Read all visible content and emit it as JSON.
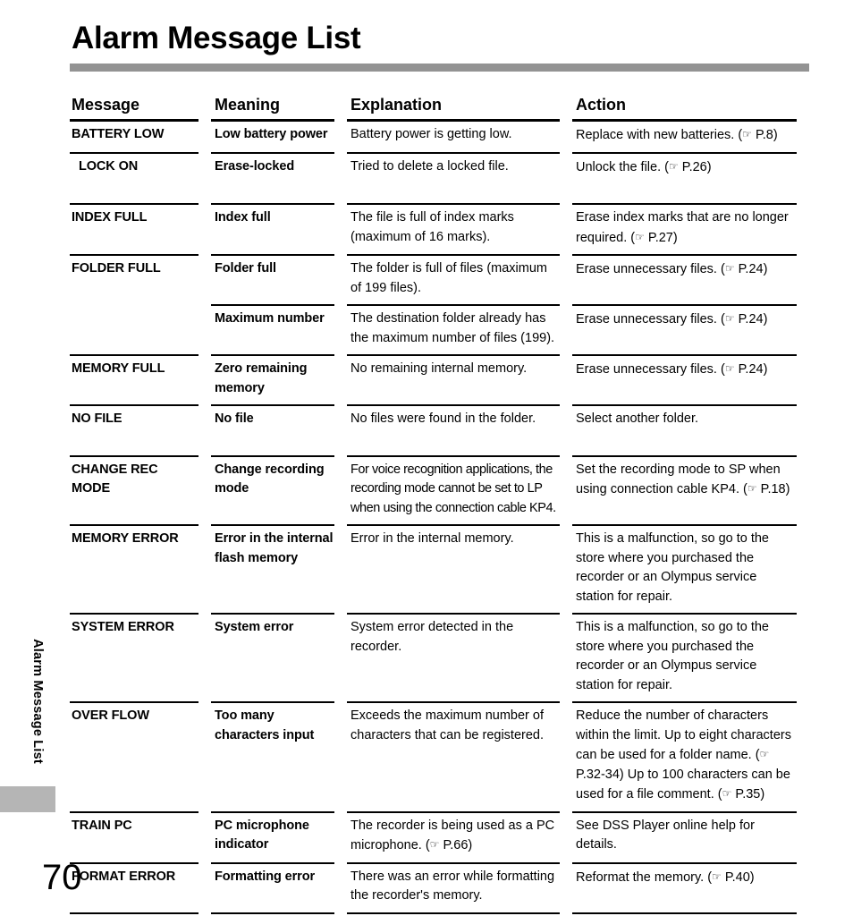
{
  "page": {
    "title": "Alarm Message List",
    "running_head": "Alarm Message List",
    "page_number": "70",
    "rule_color": "#939393",
    "tab_color": "#b5b5b5"
  },
  "table": {
    "headers": {
      "message": "Message",
      "meaning": "Meaning",
      "explanation": "Explanation",
      "action": "Action"
    },
    "rows": [
      {
        "message": "BATTERY LOW",
        "meaning": "Low battery power",
        "explanation": "Battery power is getting low.",
        "action": "Replace with new batteries. (☞ P.8)"
      },
      {
        "message": "LOCK ON",
        "meaning": "Erase-locked",
        "explanation": "Tried to delete a locked file.",
        "action": "Unlock the file. (☞ P.26)"
      },
      {
        "message": "INDEX FULL",
        "meaning": "Index full",
        "explanation": "The file is full of index marks (maximum of 16 marks).",
        "action": "Erase index marks that are no longer required. (☞ P.27)"
      },
      {
        "message": "FOLDER FULL",
        "meaning": "Folder full",
        "explanation": "The folder is full of files (maximum of 199 files).",
        "action": "Erase unnecessary files. (☞ P.24)"
      },
      {
        "message": "",
        "meaning": "Maximum number",
        "explanation": "The destination folder already has the maximum number of files (199).",
        "action": "Erase unnecessary files. (☞ P.24)"
      },
      {
        "message": "MEMORY FULL",
        "meaning": "Zero remaining memory",
        "explanation": "No remaining internal memory.",
        "action": "Erase unnecessary files. (☞ P.24)"
      },
      {
        "message": "NO FILE",
        "meaning": "No file",
        "explanation": "No files were found in the folder.",
        "action": "Select another folder."
      },
      {
        "message": "CHANGE REC MODE",
        "meaning": "Change recording mode",
        "explanation": "For voice recognition applications, the recording mode cannot be set to LP when using the connection cable KP4.",
        "action": "Set the recording mode to SP when using connection cable KP4. (☞ P.18)"
      },
      {
        "message": "MEMORY ERROR",
        "meaning": "Error in the internal flash memory",
        "explanation": "Error in the internal memory.",
        "action": "This is a malfunction, so go to the store where you purchased the recorder or an Olympus service station for repair."
      },
      {
        "message": "SYSTEM ERROR",
        "meaning": "System error",
        "explanation": "System error detected in the recorder.",
        "action": "This is a malfunction, so go to the store where you purchased the recorder or an Olympus service station for repair."
      },
      {
        "message": "OVER FLOW",
        "meaning": "Too many characters input",
        "explanation": "Exceeds the maximum number of characters that can be registered.",
        "action": "Reduce the number of characters within the limit. Up to eight characters can be used for a folder name. (☞ P.32-34) Up to 100 characters can be used for a file comment. (☞ P.35)"
      },
      {
        "message": "TRAIN PC",
        "meaning": "PC microphone indicator",
        "explanation": "The recorder is being used as a PC microphone. (☞ P.66)",
        "action": "See DSS Player online help for details."
      },
      {
        "message": "FORMAT ERROR",
        "meaning": "Formatting error",
        "explanation": "There was an error while formatting the recorder's memory.",
        "action": "Reformat the memory. (☞ P.40)"
      }
    ]
  }
}
